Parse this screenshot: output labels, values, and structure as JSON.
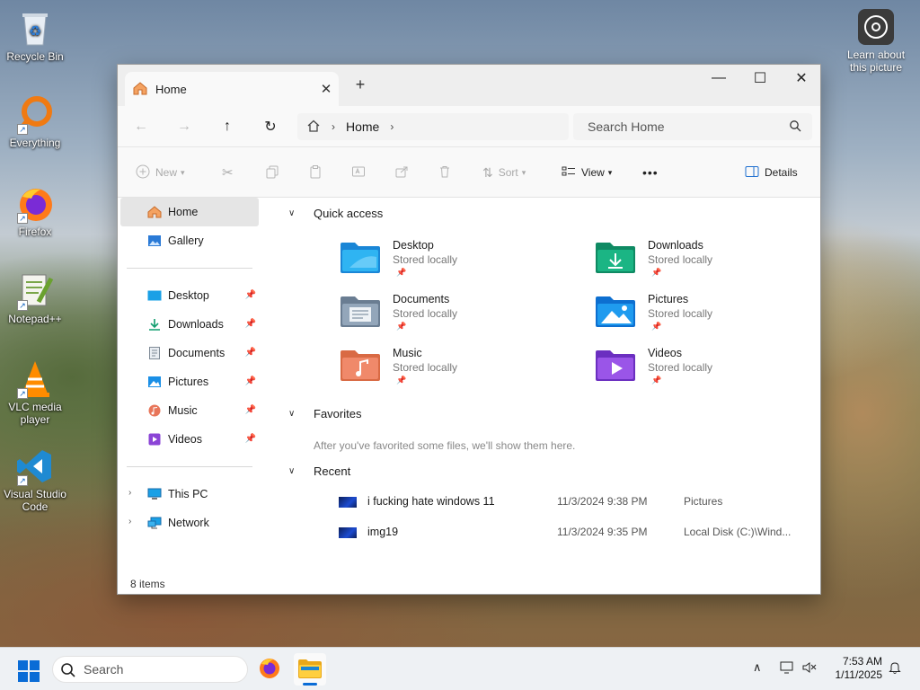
{
  "desktop": {
    "icons": [
      {
        "label": "Recycle Bin"
      },
      {
        "label": "Everything"
      },
      {
        "label": "Firefox"
      },
      {
        "label": "Notepad++"
      },
      {
        "label": "VLC media player"
      },
      {
        "label": "Visual Studio Code"
      }
    ],
    "learn_label": "Learn about this picture"
  },
  "window": {
    "tab_title": "Home",
    "tab_close": "✕",
    "new_tab": "+",
    "controls": {
      "minimize": "—",
      "maximize": "☐",
      "close": "✕"
    },
    "breadcrumb": {
      "current": "Home",
      "separator": "›"
    },
    "search_placeholder": "Search Home",
    "toolbar": {
      "new_label": "New",
      "sort_label": "Sort",
      "view_label": "View",
      "more_label": "•••",
      "details_label": "Details"
    },
    "sidebar": {
      "top": [
        {
          "label": "Home"
        },
        {
          "label": "Gallery"
        }
      ],
      "pinned": [
        {
          "label": "Desktop"
        },
        {
          "label": "Downloads"
        },
        {
          "label": "Documents"
        },
        {
          "label": "Pictures"
        },
        {
          "label": "Music"
        },
        {
          "label": "Videos"
        }
      ],
      "drives": [
        {
          "label": "This PC"
        },
        {
          "label": "Network"
        }
      ]
    },
    "quick_access": {
      "title": "Quick access",
      "items": [
        {
          "name": "Desktop",
          "sub": "Stored locally"
        },
        {
          "name": "Downloads",
          "sub": "Stored locally"
        },
        {
          "name": "Documents",
          "sub": "Stored locally"
        },
        {
          "name": "Pictures",
          "sub": "Stored locally"
        },
        {
          "name": "Music",
          "sub": "Stored locally"
        },
        {
          "name": "Videos",
          "sub": "Stored locally"
        }
      ]
    },
    "favorites": {
      "title": "Favorites",
      "empty_text": "After you've favorited some files, we'll show them here."
    },
    "recent": {
      "title": "Recent",
      "rows": [
        {
          "name": "i fucking hate windows 11",
          "date": "11/3/2024 9:38 PM",
          "location": "Pictures"
        },
        {
          "name": "img19",
          "date": "11/3/2024 9:35 PM",
          "location": "Local Disk (C:)\\Wind..."
        }
      ]
    },
    "status": "8 items"
  },
  "taskbar": {
    "search_placeholder": "Search",
    "time": "7:53 AM",
    "date": "1/11/2025"
  }
}
